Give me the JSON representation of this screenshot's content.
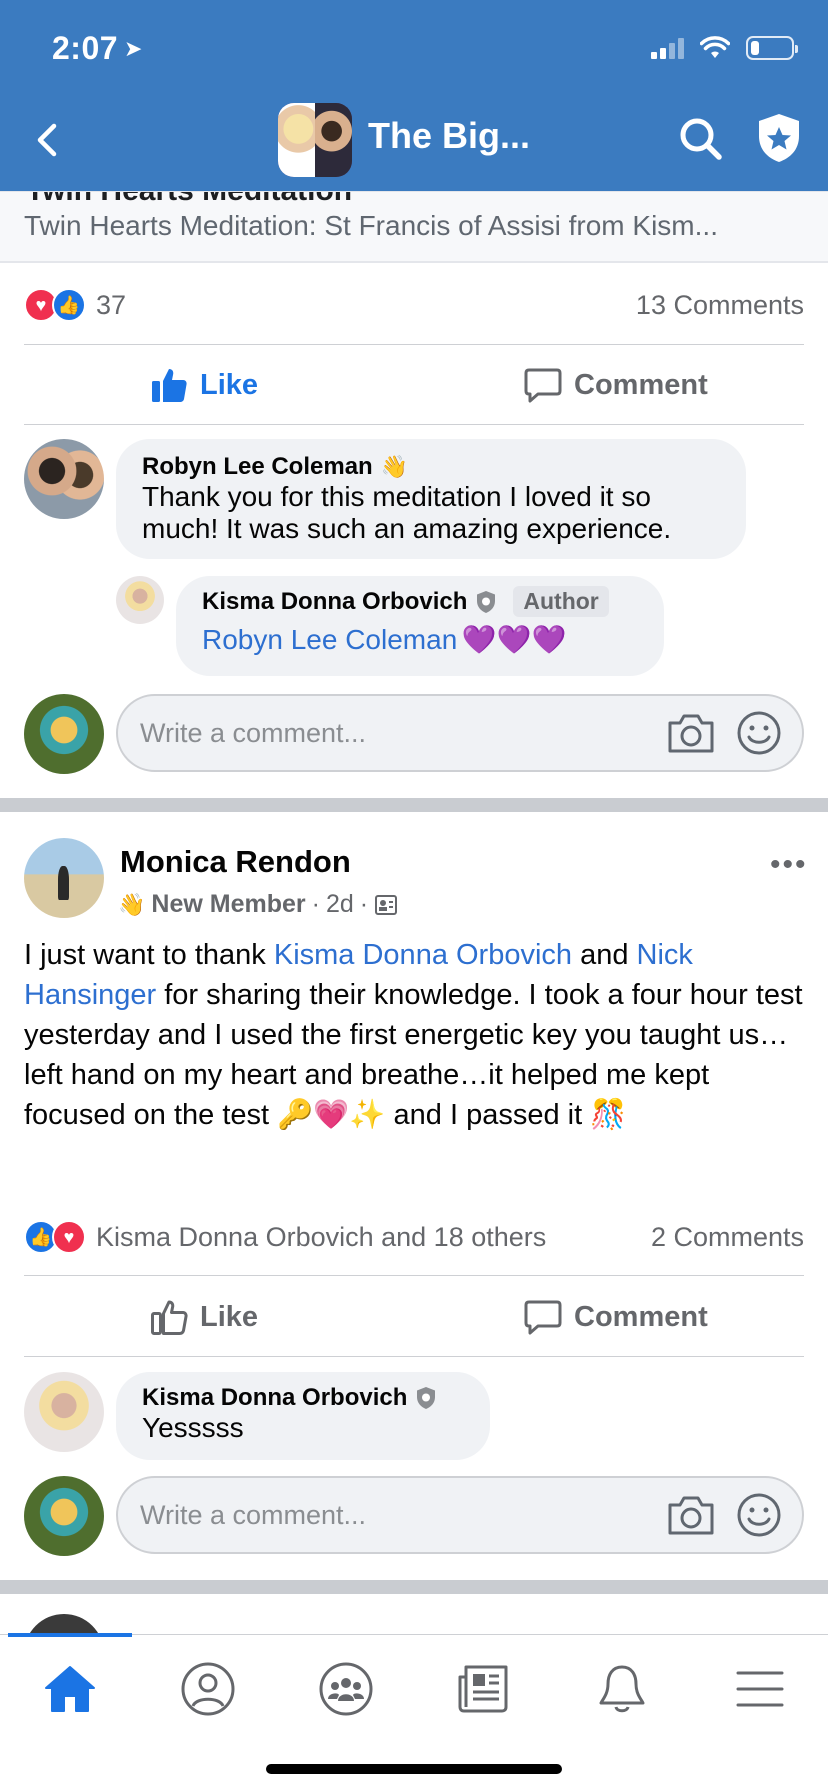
{
  "status": {
    "time": "2:07",
    "battery_level": 0.2
  },
  "header": {
    "group_name": "The Big..."
  },
  "link_preview": {
    "title": "Twin Hearts Meditation: St Francis of Assisi from Kism...",
    "cut_title": "Twin Hearts Meditation"
  },
  "post1": {
    "reactions_count": "37",
    "comments_count": "13 Comments",
    "like_label": "Like",
    "comment_label": "Comment",
    "comment": {
      "author": "Robyn Lee Coleman",
      "text": "Thank you for this meditation I loved it so much! It was such an amazing experience."
    },
    "reply": {
      "author": "Kisma Donna Orbovich",
      "badge": "Author",
      "mention": "Robyn Lee Coleman",
      "emoji": "💜💜💜"
    },
    "write_placeholder": "Write a comment..."
  },
  "post2": {
    "author": "Monica Rendon",
    "member_label": "New Member",
    "time": "2d",
    "body": {
      "part1": "I just want to thank ",
      "mention1": "Kisma Donna Orbovich",
      "part2": " and ",
      "mention2": "Nick Hansinger",
      "part3": " for sharing their knowledge. I took a four hour test yesterday and I used the first energetic key you taught us…left hand on my heart and breathe…it helped me kept focused on the test ",
      "emoji1": "🔑💗✨",
      "part4": " and I passed it ",
      "emoji2": "🎊"
    },
    "reactions_text": "Kisma Donna Orbovich and 18 others",
    "comments_count": "2 Comments",
    "like_label": "Like",
    "comment_label": "Comment",
    "comment": {
      "author": "Kisma Donna Orbovich",
      "text": "Yesssss"
    },
    "write_placeholder": "Write a comment..."
  },
  "icons": {
    "nav": [
      "home-icon",
      "profile-icon",
      "groups-icon",
      "news-icon",
      "bell-icon",
      "menu-icon"
    ]
  },
  "colors": {
    "header_bg": "#3b7bc0",
    "accent": "#1b74e4",
    "mention": "#2d6fd0"
  }
}
